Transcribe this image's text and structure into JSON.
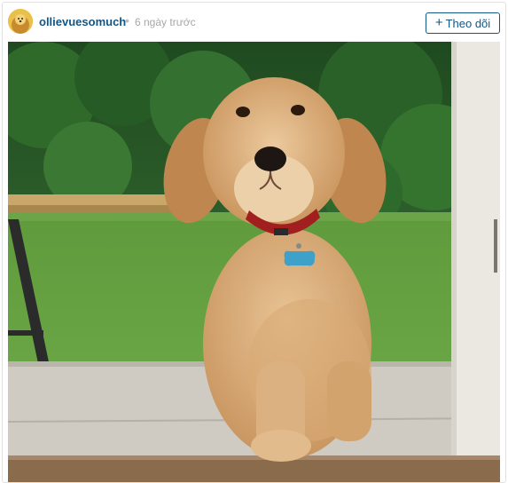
{
  "post": {
    "username": "ollievuesomuch",
    "separator": "•",
    "time_ago": "6 ngày trước",
    "follow_label": "Theo dõi",
    "follow_icon": "+"
  },
  "icons": {
    "avatar": "avatar-image",
    "follow": "plus-icon"
  },
  "colors": {
    "username": "#125688",
    "follow_button": "#125688",
    "timestamp": "#a5a7aa"
  }
}
